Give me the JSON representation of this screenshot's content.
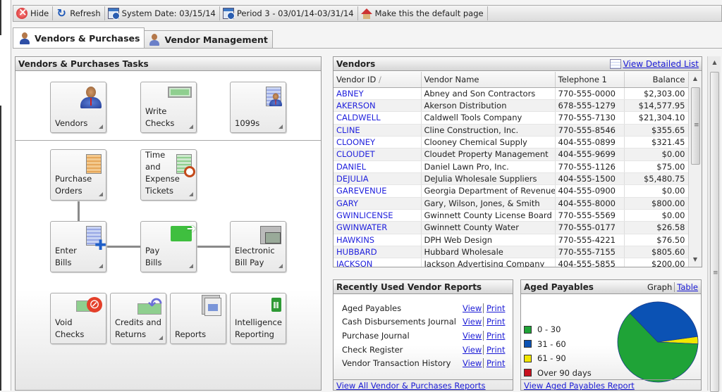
{
  "toolbar": {
    "items": [
      {
        "label": "Hide",
        "icon": "hide-icon"
      },
      {
        "label": "Refresh",
        "icon": "refresh-icon"
      },
      {
        "label": "System Date: 03/15/14",
        "icon": "calendar-icon"
      },
      {
        "label": "Period 3 - 03/01/14-03/31/14",
        "icon": "calendar-icon"
      },
      {
        "label": "Make this the default page",
        "icon": "home-icon"
      }
    ]
  },
  "tabs": [
    {
      "label": "Vendors & Purchases",
      "active": true
    },
    {
      "label": "Vendor Management",
      "active": false
    }
  ],
  "tasks": {
    "title": "Vendors & Purchases Tasks",
    "tiles": {
      "vendors": "Vendors",
      "write_checks": "Write\nChecks",
      "t1099": "1099s",
      "purchase_orders": "Purchase\nOrders",
      "time_expense": "Time\nand Expense\nTickets",
      "enter_bills": "Enter\nBills",
      "pay_bills": "Pay\nBills",
      "ebp": "Electronic\nBill Pay",
      "void_checks": "Void\nChecks",
      "credits": "Credits and\nReturns",
      "reports": "Reports",
      "intel": "Intelligence\nReporting"
    }
  },
  "vendors": {
    "title": "Vendors",
    "view_detailed": "View Detailed List",
    "columns": [
      "Vendor ID",
      "Vendor Name",
      "Telephone 1",
      "Balance"
    ],
    "sort_indicator": "/",
    "rows": [
      [
        "ABNEY",
        "Abney and Son Contractors",
        "770-555-0000",
        "$2,303.00"
      ],
      [
        "AKERSON",
        "Akerson Distribution",
        "678-555-1279",
        "$14,577.95"
      ],
      [
        "CALDWELL",
        "Caldwell Tools Company",
        "770-555-7130",
        "$21,304.10"
      ],
      [
        "CLINE",
        "Cline Construction, Inc.",
        "770-555-8546",
        "$355.65"
      ],
      [
        "CLOONEY",
        "Clooney Chemical Supply",
        "404-555-0899",
        "$321.45"
      ],
      [
        "CLOUDET",
        "Cloudet Property Management",
        "404-555-9699",
        "$0.00"
      ],
      [
        "DANIEL",
        "Daniel Lawn Pro, Inc.",
        "770-555-1126",
        "$75.00"
      ],
      [
        "DEJULIA",
        "DeJulia Wholesale Suppliers",
        "404-555-1500",
        "$5,480.75"
      ],
      [
        "GAREVENUE",
        "Georgia Department of Revenue",
        "404-555-0900",
        "$0.00"
      ],
      [
        "GARY",
        "Gary, Wilson, Jones, & Smith",
        "404-555-8000",
        "$800.00"
      ],
      [
        "GWINLICENSE",
        "Gwinnett County License Board",
        "770-555-5569",
        "$0.00"
      ],
      [
        "GWINWATER",
        "Gwinnett County Water",
        "770-555-0177",
        "$26.58"
      ],
      [
        "HAWKINS",
        "DPH Web Design",
        "770-555-4221",
        "$76.50"
      ],
      [
        "HUBBARD",
        "Hubbard Wholesale",
        "770-555-7155",
        "$805.60"
      ],
      [
        "JACKSON",
        "Jackson Advertising Company",
        "404-555-5855",
        "$200.00"
      ]
    ]
  },
  "reports": {
    "title": "Recently Used Vendor Reports",
    "view_label": "View",
    "print_label": "Print",
    "items": [
      "Aged Payables",
      "Cash Disbursements Journal",
      "Purchase Journal",
      "Check Register",
      "Vendor Transaction History"
    ],
    "footer": "View All Vendor & Purchases Reports"
  },
  "aged": {
    "title": "Aged Payables",
    "graph_label": "Graph",
    "table_label": "Table",
    "footer": "View Aged Payables Report",
    "legend": [
      {
        "label": "0 - 30",
        "color": "#1fa337"
      },
      {
        "label": "31 - 60",
        "color": "#0b52b4"
      },
      {
        "label": "61 - 90",
        "color": "#f2e600"
      },
      {
        "label": "Over 90 days",
        "color": "#c8101e"
      }
    ],
    "slices": [
      62,
      35,
      3,
      0
    ]
  }
}
